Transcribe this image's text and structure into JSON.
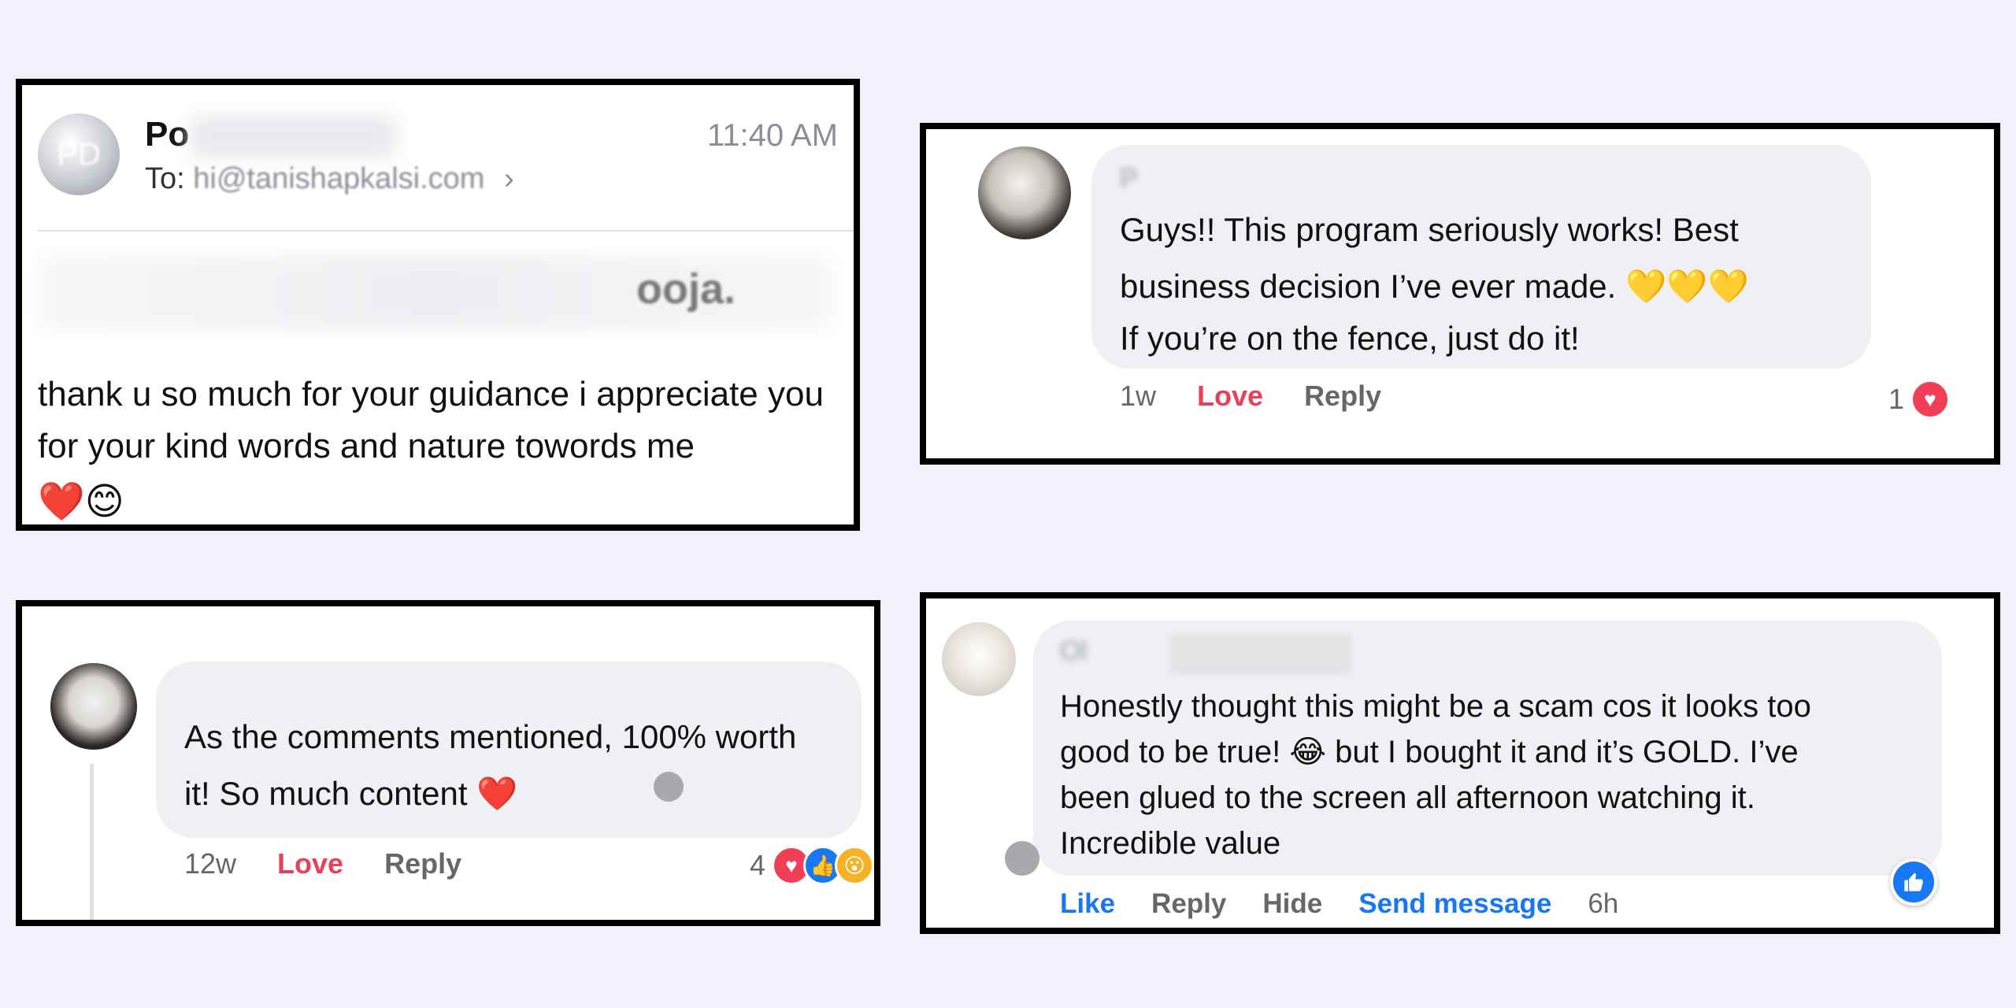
{
  "email": {
    "avatar_initials": "PD",
    "sender_visible": "Po",
    "to_label": "To:",
    "to_address": "hi@tanishapkalsi.com",
    "chevron": "›",
    "time": "11:40 AM",
    "greeting_fragment": "ooja.",
    "body": "thank u so much for your guidance i appreciate you for your kind words and nature towords me",
    "emojis": "❤️😊"
  },
  "comment_1": {
    "name": "P",
    "text_line1": "Guys!! This program seriously works! Best",
    "text_line2": "business decision I’ve ever made. 💛💛💛",
    "text_line3": "If you’re on the fence, just do it!",
    "time": "1w",
    "love": "Love",
    "reply": "Reply",
    "reaction_count": "1",
    "reactions": [
      "heart-reaction"
    ]
  },
  "comment_2": {
    "name": "",
    "text_line1": "As the comments mentioned, 100% worth",
    "text_line2": "it! So much content ❤️",
    "time": "12w",
    "love": "Love",
    "reply": "Reply",
    "reaction_count": "4",
    "reactions": [
      "heart-reaction",
      "like-reaction",
      "wow-reaction"
    ]
  },
  "comment_3": {
    "name": "Ol",
    "text_line1": "Honestly thought this might be a scam cos it looks too",
    "text_line2": "good to be true! 😂 but I bought it and it’s GOLD. I’ve",
    "text_line3": "been glued to the screen all afternoon watching it.",
    "text_line4": "Incredible value",
    "like": "Like",
    "reply": "Reply",
    "hide": "Hide",
    "send_message": "Send message",
    "time": "6h"
  },
  "colors": {
    "background": "#f1f0fb",
    "love_red": "#e8405a",
    "facebook_blue": "#1877f2",
    "bubble_gray": "#eef0f3"
  }
}
